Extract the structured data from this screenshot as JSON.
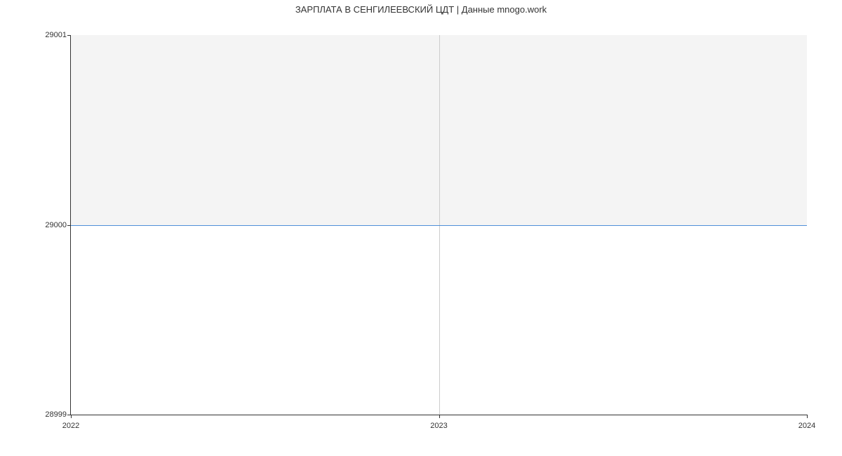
{
  "chart_data": {
    "type": "line",
    "title": "ЗАРПЛАТА В СЕНГИЛЕЕВСКИЙ ЦДТ | Данные mnogo.work",
    "xlabel": "",
    "ylabel": "",
    "x": [
      2022,
      2023,
      2024
    ],
    "y": [
      29000,
      29000,
      29000
    ],
    "ylim": [
      28999,
      29001
    ],
    "xlim": [
      2022,
      2024
    ],
    "y_ticks": [
      "28999",
      "29000",
      "29001"
    ],
    "x_ticks": [
      "2022",
      "2023",
      "2024"
    ]
  }
}
